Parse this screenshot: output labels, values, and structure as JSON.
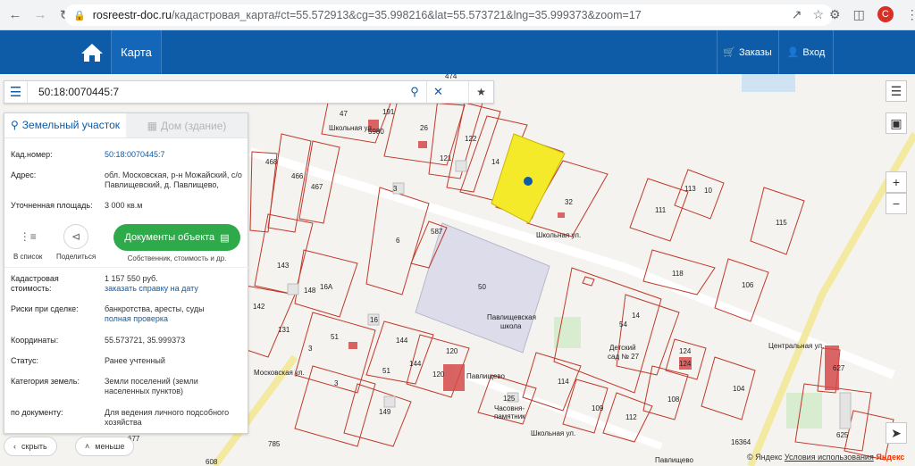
{
  "browser": {
    "url_host": "rosreestr-doc.ru",
    "url_path": "/кадастровая_карта#ct=55.572913&cg=35.998216&lat=55.573721&lng=35.999373&zoom=17",
    "profile_initial": "С"
  },
  "header": {
    "tab_label": "Карта",
    "orders_label": "Заказы",
    "login_label": "Вход"
  },
  "search": {
    "value": "50:18:0070445:7"
  },
  "panel": {
    "tab_active": "Земельный участок",
    "tab_inactive": "Дом (здание)",
    "fields": {
      "cad_label": "Кад.номер:",
      "cad_value": "50:18:0070445:7",
      "addr_label": "Адрес:",
      "addr_value": "обл. Московская, р-н Можайский, с/о Павлищевский, д. Павлищево,",
      "area_label": "Уточненная площадь:",
      "area_value": "3 000 кв.м",
      "cost_label": "Кадастровая стоимость:",
      "cost_value": "1 157 550 руб.",
      "cost_link": "заказать справку на дату",
      "risk_label": "Риски при сделке:",
      "risk_value": "банкротства, аресты, суды",
      "risk_link": "полная проверка",
      "coord_label": "Координаты:",
      "coord_value": "55.573721, 35.999373",
      "status_label": "Статус:",
      "status_value": "Ранее учтенный",
      "cat_label": "Категория земель:",
      "cat_value": "Земли поселений (земли населенных пунктов)",
      "doc_label": "по документу:",
      "doc_value": "Для ведения личного подсобного хозяйства"
    },
    "actions": {
      "list_label": "В список",
      "share_label": "Поделиться",
      "docs_button": "Документы объекта",
      "docs_sub": "Собственник, стоимость и др."
    }
  },
  "bottom": {
    "hide_label": "скрыть",
    "less_label": "меньше"
  },
  "map": {
    "attribution": "© Яндекс",
    "terms_link": "Условия использования",
    "logo": "Яндекс",
    "labels": {
      "l47": "47",
      "l191": "191",
      "l26": "26",
      "l474": "474",
      "l122": "122",
      "l121": "121",
      "l14": "14",
      "l32": "32",
      "l468": "468",
      "l466": "466",
      "l467": "467",
      "l3": "3",
      "l6": "6",
      "l587": "587",
      "l143": "143",
      "l148": "148",
      "l16a": "16А",
      "l142": "142",
      "l131": "131",
      "l16": "16",
      "l51a": "51",
      "l144": "144",
      "l120": "120",
      "l51b": "51",
      "l149": "149",
      "l3b": "3",
      "l3c": "3",
      "l50": "50",
      "school1": "Павлищевская",
      "school2": "школа",
      "l54": "54",
      "l14b": "14",
      "kinder1": "Детский",
      "kinder2": "сад № 27",
      "l124": "124",
      "l124b": "124",
      "l111": "111",
      "l113": "113",
      "l10": "10",
      "l115": "115",
      "l118": "118",
      "l106": "106",
      "l114": "114",
      "l109": "109",
      "l112": "112",
      "l108": "108",
      "l104": "104",
      "l125": "125",
      "chapel1": "Часовня-",
      "chapel2": "памятник",
      "l625": "625",
      "l627": "627",
      "l677": "677",
      "l608": "608",
      "l785": "785",
      "l5980": "5980",
      "street1": "Школьная ул.",
      "street2": "Школьная ул.",
      "street3": "Школьная ул.",
      "street4": "Центральная ул.",
      "street5": "Московская ул.",
      "pav1": "Павлищево",
      "pav2": "Павлищево",
      "l16364": "16364"
    }
  }
}
